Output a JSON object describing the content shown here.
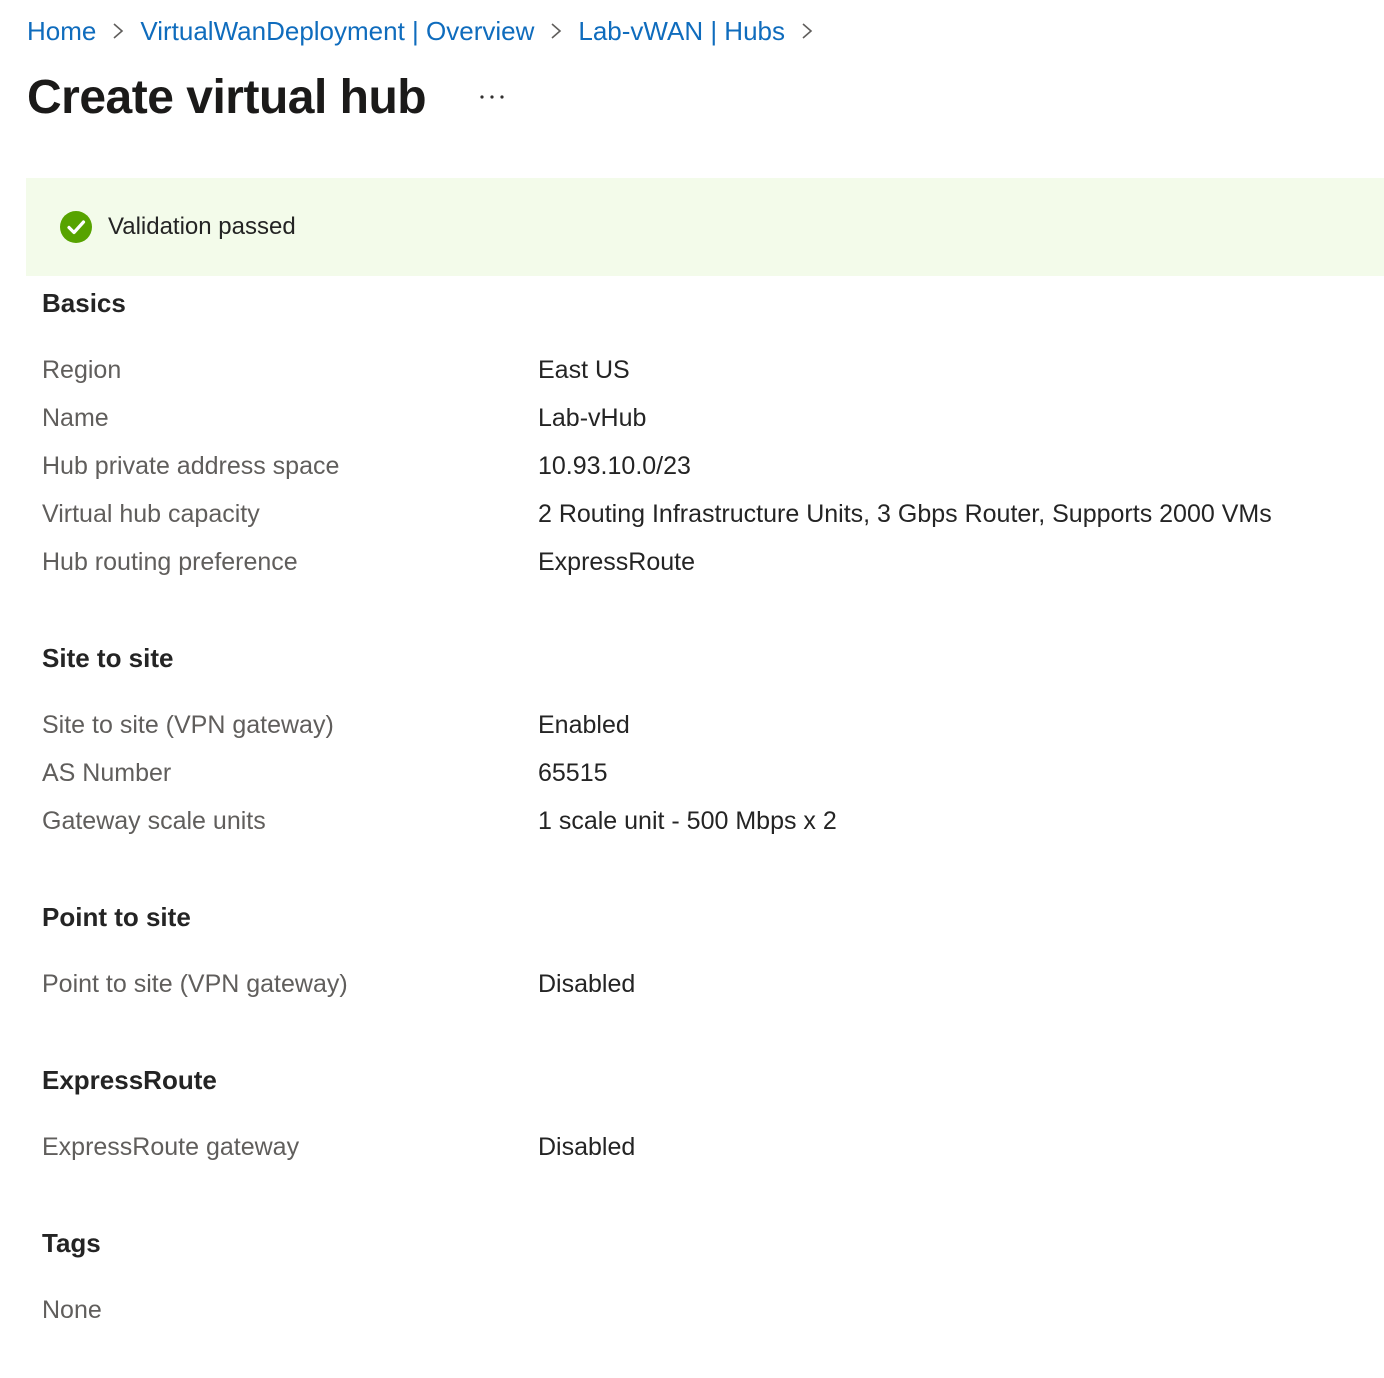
{
  "breadcrumb": {
    "items": [
      "Home",
      "VirtualWanDeployment | Overview",
      "Lab-vWAN | Hubs"
    ]
  },
  "page": {
    "title": "Create virtual hub",
    "more_label": "···"
  },
  "validation": {
    "message": "Validation passed",
    "status_color": "#57a300",
    "icon": "checkmark-circle-icon"
  },
  "sections": {
    "basics": {
      "title": "Basics",
      "rows": [
        {
          "label": "Region",
          "value": "East US"
        },
        {
          "label": "Name",
          "value": "Lab-vHub"
        },
        {
          "label": "Hub private address space",
          "value": "10.93.10.0/23"
        },
        {
          "label": "Virtual hub capacity",
          "value": "2 Routing Infrastructure Units, 3 Gbps Router, Supports 2000 VMs"
        },
        {
          "label": "Hub routing preference",
          "value": "ExpressRoute"
        }
      ]
    },
    "site_to_site": {
      "title": "Site to site",
      "rows": [
        {
          "label": "Site to site (VPN gateway)",
          "value": "Enabled"
        },
        {
          "label": "AS Number",
          "value": "65515"
        },
        {
          "label": "Gateway scale units",
          "value": "1 scale unit - 500 Mbps x 2"
        }
      ]
    },
    "point_to_site": {
      "title": "Point to site",
      "rows": [
        {
          "label": "Point to site (VPN gateway)",
          "value": "Disabled"
        }
      ]
    },
    "expressroute": {
      "title": "ExpressRoute",
      "rows": [
        {
          "label": "ExpressRoute gateway",
          "value": "Disabled"
        }
      ]
    },
    "tags": {
      "title": "Tags",
      "value": "None"
    }
  }
}
